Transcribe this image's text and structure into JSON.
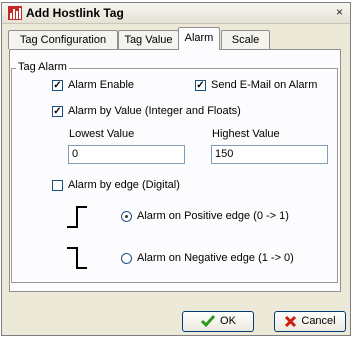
{
  "window": {
    "title": "Add Hostlink Tag",
    "close_symbol": "×"
  },
  "tabs": [
    {
      "label": "Tag Configuration",
      "active": false
    },
    {
      "label": "Tag Value",
      "active": false
    },
    {
      "label": "Alarm",
      "active": true
    },
    {
      "label": "Scale",
      "active": false
    }
  ],
  "alarm_group": {
    "title": "Tag Alarm",
    "alarm_enable": {
      "label": "Alarm Enable",
      "checked": true
    },
    "send_email": {
      "label": "Send E-Mail on Alarm",
      "checked": true
    },
    "alarm_by_value": {
      "label": "Alarm by Value (Integer and Floats)",
      "checked": true
    },
    "lowest_value": {
      "label": "Lowest Value",
      "value": "0"
    },
    "highest_value": {
      "label": "Highest Value",
      "value": "150"
    },
    "alarm_by_edge": {
      "label": "Alarm by edge (Digital)",
      "checked": false
    },
    "positive_edge": {
      "label": "Alarm on Positive edge (0 -> 1)",
      "selected": true
    },
    "negative_edge": {
      "label": "Alarm on Negative edge (1 -> 0)",
      "selected": false
    }
  },
  "buttons": {
    "ok": "OK",
    "cancel": "Cancel"
  },
  "colors": {
    "ok_check": "#2e9a1c",
    "cancel_x": "#d01d0e",
    "window_bg": "#ece9d8",
    "panel_bg": "#fcfcfe"
  },
  "icons": {
    "app": "bar-chart-icon",
    "ok": "checkmark-icon",
    "cancel": "red-x-icon"
  }
}
